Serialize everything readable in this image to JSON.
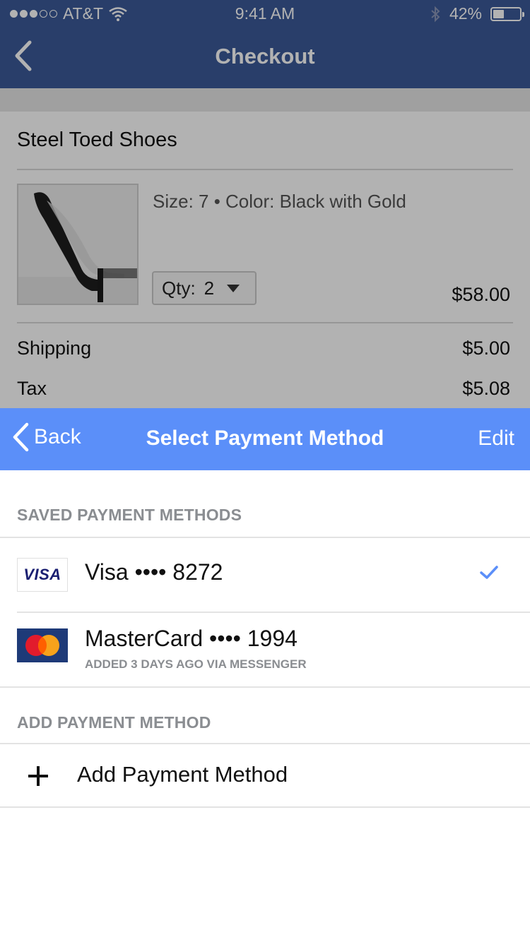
{
  "status_bar": {
    "carrier": "AT&T",
    "time": "9:41 AM",
    "battery_text": "42%",
    "battery_level": 0.42
  },
  "checkout": {
    "title": "Checkout",
    "product": {
      "name": "Steel Toed Shoes",
      "variant": "Size: 7 • Color: Black with Gold",
      "qty_label": "Qty:",
      "qty_value": "2",
      "price": "$58.00"
    },
    "rows": [
      {
        "label": "Shipping",
        "value": "$5.00"
      },
      {
        "label": "Tax",
        "value": "$5.08"
      }
    ]
  },
  "payment_sheet": {
    "back_label": "Back",
    "title": "Select Payment Method",
    "edit_label": "Edit",
    "saved_header": "SAVED PAYMENT METHODS",
    "methods": [
      {
        "brand": "VISA",
        "title": "Visa •••• 8272",
        "subtitle": "",
        "selected": true
      },
      {
        "brand": "MasterCard",
        "title": "MasterCard •••• 1994",
        "subtitle": "ADDED 3 DAYS AGO VIA MESSENGER",
        "selected": false
      }
    ],
    "add_header": "ADD PAYMENT METHOD",
    "add_label": "Add Payment Method"
  },
  "colors": {
    "nav_dark": "#3b5998",
    "nav_light": "#5b8ff9",
    "check": "#5b8ff9",
    "section_text": "#8a8d91"
  },
  "icons": [
    "signal-dots-icon",
    "wifi-icon",
    "bluetooth-icon",
    "battery-icon",
    "chevron-left-icon",
    "dropdown-caret-icon",
    "visa-logo",
    "mastercard-logo",
    "checkmark-icon",
    "plus-icon"
  ]
}
